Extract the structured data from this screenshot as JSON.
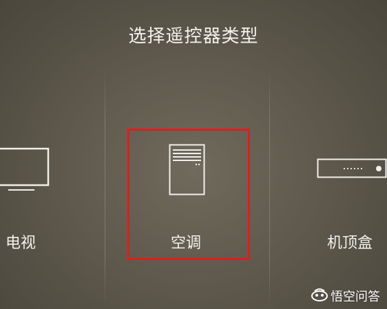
{
  "header": {
    "title": "选择遥控器类型"
  },
  "devices": [
    {
      "label": "电视",
      "icon": "tv-icon",
      "selected": false
    },
    {
      "label": "空调",
      "icon": "air-conditioner-icon",
      "selected": true
    },
    {
      "label": "机顶盒",
      "icon": "set-top-box-icon",
      "selected": false
    }
  ],
  "selection": {
    "highlight_color": "#e31b1b"
  },
  "watermark": {
    "text": "悟空问答",
    "icon": "wukong-logo-icon"
  },
  "colors": {
    "background": "#5f5a4d",
    "foreground": "#f1f0ec"
  }
}
